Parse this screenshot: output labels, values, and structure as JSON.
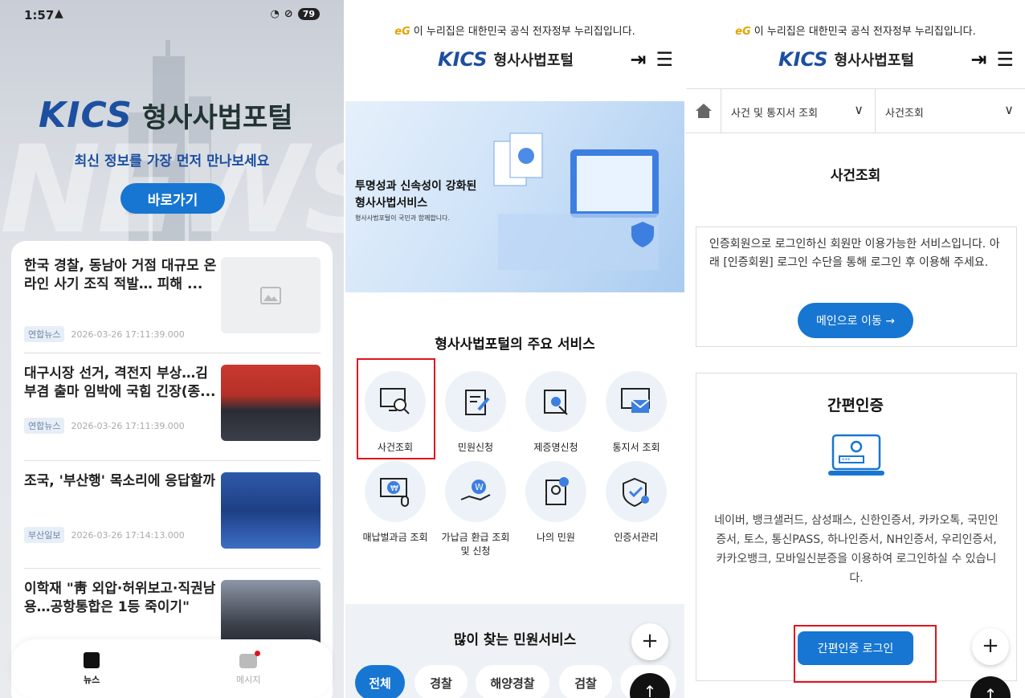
{
  "phone": {
    "time": "1:57",
    "battery": "79",
    "hero": {
      "logo": "KICS",
      "portal": "형사사법포털",
      "tagline": "최신 정보를 가장 먼저 만나보세요",
      "go_button": "바로가기"
    },
    "news": [
      {
        "title": "한국 경찰, 동남아 거점 대규모 온라인 사기 조직 적발… 피해 ...",
        "source": "연합뉴스",
        "date": "2026-03-26 17:11:39.000"
      },
      {
        "title": "대구시장 선거, 격전지 부상…김부겸 출마 임박에 국힘 긴장(종...",
        "source": "연합뉴스",
        "date": "2026-03-26 17:11:39.000"
      },
      {
        "title": "조국, '부산행' 목소리에 응답할까",
        "source": "부산일보",
        "date": "2026-03-26 17:14:13.000"
      },
      {
        "title": "이학재 \"靑 외압·허위보고·직권남용…공항통합은 1등 죽이기\"",
        "source": "",
        "date": ""
      }
    ],
    "nav": {
      "news": "뉴스",
      "message": "메시지"
    }
  },
  "portal": {
    "gov_notice": "이 누리집은 대한민국 공식 전자정부 누리집입니다.",
    "eg": "eG",
    "logo": "KICS",
    "name": "형사사법포털",
    "banner": {
      "line1": "투명성과 신속성이 강화된",
      "line2": "형사사법서비스",
      "sub": "형사사법포털이 국민과 함께합니다."
    },
    "main_services_title": "형사사법포털의 주요 서비스",
    "services": [
      "사건조회",
      "민원신청",
      "제증명신청",
      "통지서 조회",
      "매납벌과금 조회",
      "가납금 환급 조회",
      "및 신청",
      "나의 민원",
      "인증서관리"
    ],
    "popular_title": "많이 찾는 민원서비스",
    "chips": [
      "전체",
      "경찰",
      "해양경찰",
      "검찰"
    ]
  },
  "lookup": {
    "breadcrumb": [
      "사건 및 통지서 조회",
      "사건조회"
    ],
    "page_title": "사건조회",
    "notice": "인증회원으로 로그인하신 회원만 이용가능한 서비스입니다. 아래 [인증회원] 로그인 수단을 통해 로그인 후 이용해 주세요.",
    "main_button": "메인으로 이동 →",
    "easy_title": "간편인증",
    "easy_desc": "네이버, 뱅크샐러드, 삼성패스, 신한인증서, 카카오톡, 국민인증서, 토스, 통신PASS, 하나인증서, NH인증서, 우리인증서, 카카오뱅크, 모바일신분증을 이용하여 로그인하실 수 있습니다.",
    "easy_button": "간편인증 로그인"
  },
  "colors": {
    "brand": "#1d4fa0",
    "button": "#1776d2",
    "highlight": "#e0141e"
  }
}
